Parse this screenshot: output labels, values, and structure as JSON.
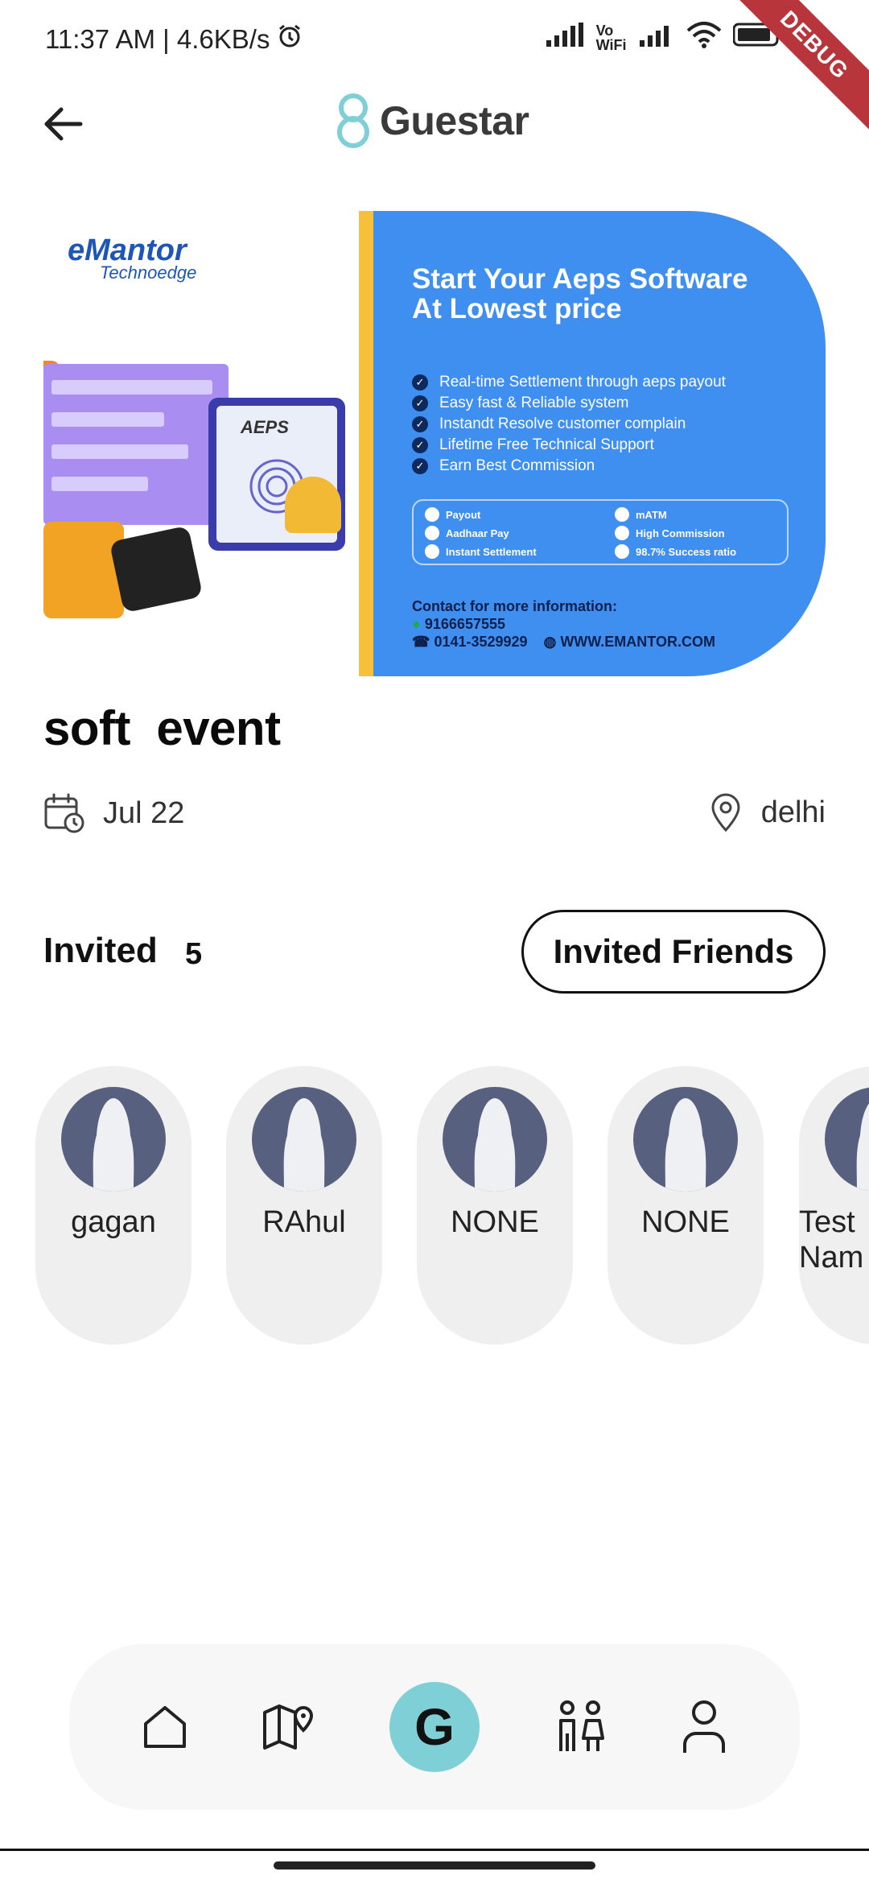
{
  "status_bar": {
    "time": "11:37 AM | 4.6KB/s",
    "vowifi": "Vo WiFi",
    "battery": "85",
    "debug_label": "DEBUG"
  },
  "header": {
    "brand_name": "Guestar"
  },
  "banner": {
    "logo_text": "eMantor",
    "logo_sub": "Technoedge",
    "title": "Start Your Aeps Software At Lowest price",
    "features": [
      "Real-time Settlement through aeps payout",
      "Easy fast & Reliable system",
      "Instandt Resolve customer complain",
      "Lifetime Free Technical Support",
      "Earn Best Commission"
    ],
    "badges": [
      "Payout",
      "mATM",
      "Aadhaar Pay",
      "High Commission",
      "Instant Settlement",
      "98.7% Success ratio"
    ],
    "contact_heading": "Contact for more information:",
    "phone": "9166657555",
    "landline": "0141-3529929",
    "website": "WWW.EMANTOR.COM",
    "aeps_text": "AEPS"
  },
  "event": {
    "title": "soft  event",
    "date": "Jul 22",
    "location": "delhi"
  },
  "invited": {
    "label": "Invited",
    "count": "5",
    "button_label": "Invited Friends",
    "friends": [
      {
        "name": "gagan"
      },
      {
        "name": "RAhul"
      },
      {
        "name": "NONE"
      },
      {
        "name": "NONE"
      },
      {
        "name": "Test Nam"
      }
    ]
  },
  "nav": {
    "center_label": "G",
    "icons": [
      "home-icon",
      "map-pin-icon",
      "g-logo",
      "people-icon",
      "profile-icon"
    ]
  },
  "colors": {
    "banner_blue": "#3f8ff0",
    "accent_teal": "#7fcfd6",
    "avatar_bg": "#58607f",
    "debug_red": "#b8353b"
  }
}
